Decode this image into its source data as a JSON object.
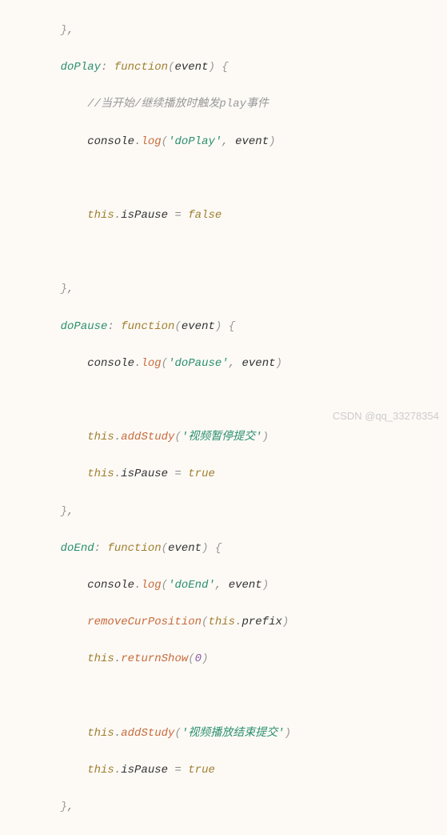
{
  "code": {
    "indent1": "    ",
    "indent2": "        ",
    "braceClose": "}",
    "braceOpen": "{",
    "comma": ",",
    "colon": ": ",
    "lparen": "(",
    "rparen": ")",
    "dot": ".",
    "eq": " = ",
    "funcKw": "function",
    "thisKw": "this",
    "console": "console",
    "log": "log",
    "event": "event",
    "doPlay": "doPlay",
    "doPause": "doPause",
    "doEnd": "doEnd",
    "comment1": "//当开始/继续播放时触发play事件",
    "strDoPlay": "'doPlay'",
    "strDoPause": "'doPause'",
    "strDoEnd": "'doEnd'",
    "strPauseSubmit": "'视频暂停提交'",
    "strEndSubmit": "'视频播放结束提交'",
    "isPause": "isPause",
    "addStudy": "addStudy",
    "returnShow": "returnShow",
    "removeCurPosition": "removeCurPosition",
    "prefix": "prefix",
    "falseVal": "false",
    "trueVal": "true",
    "zero": "0",
    "sep": ", "
  },
  "watermark": "CSDN @qq_33278354"
}
